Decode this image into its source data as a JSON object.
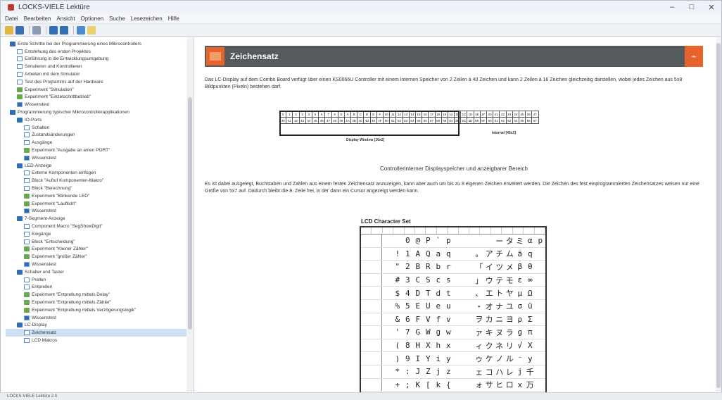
{
  "window": {
    "title": "LOCKS-VIELE Lektüre",
    "controls": [
      "–",
      "□",
      "✕"
    ]
  },
  "menu": [
    "Datei",
    "Bearbeiten",
    "Ansicht",
    "Optionen",
    "Suche",
    "Lesezeichen",
    "Hilfe"
  ],
  "toolbar": {
    "icons": [
      "open-icon",
      "save-icon",
      "print-icon",
      "back-icon",
      "forward-icon",
      "home-icon",
      "search-icon"
    ]
  },
  "tree": [
    {
      "label": "Erste Schritte bei der Programmierung eines Mikrocontrollers",
      "icon": "book",
      "indent": 0
    },
    {
      "label": "Entstehung des ersten Projektes",
      "icon": "doc",
      "indent": 1
    },
    {
      "label": "Einführung in die Entwicklungsumgebung",
      "icon": "doc",
      "indent": 1
    },
    {
      "label": "Simulieren und Kontrollieren",
      "icon": "doc",
      "indent": 1
    },
    {
      "label": "Arbeiten mit dem Simulator",
      "icon": "doc",
      "indent": 1
    },
    {
      "label": "Test des Programms auf der Hardware",
      "icon": "doc",
      "indent": 1
    },
    {
      "label": "Experiment \"Simulation\"",
      "icon": "exp",
      "indent": 1
    },
    {
      "label": "Experiment \"Einzelschrittbetrieb\"",
      "icon": "exp",
      "indent": 1
    },
    {
      "label": "Wissenstest",
      "icon": "know",
      "indent": 1
    },
    {
      "label": "Programmierung typischer Mikrocontrollerapplikationen",
      "icon": "book",
      "indent": 0
    },
    {
      "label": "IO-Ports",
      "icon": "book",
      "indent": 1
    },
    {
      "label": "Schalten",
      "icon": "doc",
      "indent": 2
    },
    {
      "label": "Zustandsänderungen",
      "icon": "doc",
      "indent": 2
    },
    {
      "label": "Ausgänge",
      "icon": "doc",
      "indent": 2
    },
    {
      "label": "Experiment \"Ausgabe an einen PORT\"",
      "icon": "exp",
      "indent": 2
    },
    {
      "label": "Wissenstest",
      "icon": "know",
      "indent": 2
    },
    {
      "label": "LED-Anzeige",
      "icon": "book",
      "indent": 1
    },
    {
      "label": "Externe Komponenten einfügen",
      "icon": "doc",
      "indent": 2
    },
    {
      "label": "Block \"Aufruf Komponenten-Makro\"",
      "icon": "doc",
      "indent": 2
    },
    {
      "label": "Block \"Berechnung\"",
      "icon": "doc",
      "indent": 2
    },
    {
      "label": "Experiment \"Blinkende LED\"",
      "icon": "exp",
      "indent": 2
    },
    {
      "label": "Experiment \"Lauflicht\"",
      "icon": "exp",
      "indent": 2
    },
    {
      "label": "Wissenstest",
      "icon": "know",
      "indent": 2
    },
    {
      "label": "7-Segment-Anzeige",
      "icon": "book",
      "indent": 1
    },
    {
      "label": "Component Macro \"SegShowDigit\"",
      "icon": "doc",
      "indent": 2
    },
    {
      "label": "Eingänge",
      "icon": "doc",
      "indent": 2
    },
    {
      "label": "Block \"Entscheidung\"",
      "icon": "doc",
      "indent": 2
    },
    {
      "label": "Experiment \"Kleiner Zähler\"",
      "icon": "exp",
      "indent": 2
    },
    {
      "label": "Experiment \"großer Zähler\"",
      "icon": "exp",
      "indent": 2
    },
    {
      "label": "Wissenstest",
      "icon": "know",
      "indent": 2
    },
    {
      "label": "Schalter und Taster",
      "icon": "book",
      "indent": 1
    },
    {
      "label": "Prellen",
      "icon": "doc",
      "indent": 2
    },
    {
      "label": "Entprellen",
      "icon": "doc",
      "indent": 2
    },
    {
      "label": "Experiment \"Entprellung mittels Delay\"",
      "icon": "exp",
      "indent": 2
    },
    {
      "label": "Experiment \"Entprellung mittels Zähler\"",
      "icon": "exp",
      "indent": 2
    },
    {
      "label": "Experiment \"Entprellung mittels Verzögerungslogik\"",
      "icon": "exp",
      "indent": 2
    },
    {
      "label": "Wissenstest",
      "icon": "know",
      "indent": 2
    },
    {
      "label": "LC-Display",
      "icon": "book",
      "indent": 1
    },
    {
      "label": "Zeichensatz",
      "icon": "doc",
      "indent": 2,
      "selected": true
    },
    {
      "label": "LCD Makros",
      "icon": "doc",
      "indent": 2
    }
  ],
  "content": {
    "title": "Zeichensatz",
    "para1": "Das LC-Display auf dem Combo Board verfügt über einen KS0066U Controller mit einem internen Speicher von 2 Zeilen à 40 Zeichen und kann 2 Zeilen à 16 Zeichen gleichzeitig darstellen, wobei jedes Zeichen aus 5x8 Bildpunkten (Pixeln) bestehen darf.",
    "table_row1": [
      "0",
      "1",
      "2",
      "3",
      "4",
      "5",
      "6",
      "7",
      "8",
      "9",
      "A",
      "B",
      "C",
      "D",
      "E",
      "F",
      "10",
      "11",
      "12",
      "13",
      "14",
      "15",
      "16",
      "17",
      "18",
      "19",
      "1A",
      "1B",
      "1C",
      "1D",
      "1E",
      "1F",
      "20",
      "21",
      "22",
      "23",
      "24",
      "25",
      "26",
      "27"
    ],
    "table_row2": [
      "40",
      "41",
      "42",
      "43",
      "44",
      "45",
      "46",
      "47",
      "48",
      "49",
      "4A",
      "4B",
      "4C",
      "4D",
      "4E",
      "4F",
      "50",
      "51",
      "52",
      "53",
      "54",
      "55",
      "56",
      "57",
      "58",
      "59",
      "5A",
      "5B",
      "5C",
      "5D",
      "5E",
      "5F",
      "60",
      "61",
      "62",
      "63",
      "64",
      "65",
      "66",
      "67"
    ],
    "display_window_label": "Display Window [16x2]",
    "internal_label": "Internal [40x2]",
    "caption": "Controllerinterner Displayspeicher und anzeigbarer Bereich",
    "para2": "Es ist dabei ausgelegt, Buchstaben und Zahlen aus einem festen Zeichensatz anzuzeigen, kann aber auch um bis zu 8 eigenen Zeichen erweitert werden. Die Zeichen des fest einprogrammierten Zeichensatzes weisen nur eine Größe von 5x7 auf. Dadurch bleibt die 8. Zeile frei, in der dann ein Cursor angezeigt werden kann.",
    "lcd_title": "LCD Character Set",
    "lcd_rows": [
      [
        "",
        "",
        "",
        "0",
        "@",
        "P",
        "`",
        "p",
        "",
        "",
        "",
        "",
        "ー",
        "タ",
        "ミ",
        "α",
        "p"
      ],
      [
        "",
        "",
        "!",
        "1",
        "A",
        "Q",
        "a",
        "q",
        "",
        "",
        "。",
        "ア",
        "チ",
        "ム",
        "ä",
        "q"
      ],
      [
        "",
        "",
        "\"",
        "2",
        "B",
        "R",
        "b",
        "r",
        "",
        "",
        "「",
        "イ",
        "ツ",
        "メ",
        "β",
        "θ"
      ],
      [
        "",
        "",
        "#",
        "3",
        "C",
        "S",
        "c",
        "s",
        "",
        "",
        "」",
        "ウ",
        "テ",
        "モ",
        "ε",
        "∞"
      ],
      [
        "",
        "",
        "$",
        "4",
        "D",
        "T",
        "d",
        "t",
        "",
        "",
        "、",
        "エ",
        "ト",
        "ヤ",
        "μ",
        "Ω"
      ],
      [
        "",
        "",
        "%",
        "5",
        "E",
        "U",
        "e",
        "u",
        "",
        "",
        "・",
        "オ",
        "ナ",
        "ユ",
        "σ",
        "ü"
      ],
      [
        "",
        "",
        "&",
        "6",
        "F",
        "V",
        "f",
        "v",
        "",
        "",
        "ヲ",
        "カ",
        "ニ",
        "ヨ",
        "ρ",
        "Σ"
      ],
      [
        "",
        "",
        "'",
        "7",
        "G",
        "W",
        "g",
        "w",
        "",
        "",
        "ァ",
        "キ",
        "ヌ",
        "ラ",
        "g",
        "π"
      ],
      [
        "",
        "",
        "(",
        "8",
        "H",
        "X",
        "h",
        "x",
        "",
        "",
        "ィ",
        "ク",
        "ネ",
        "リ",
        "√",
        "X"
      ],
      [
        "",
        "",
        ")",
        "9",
        "I",
        "Y",
        "i",
        "y",
        "",
        "",
        "ゥ",
        "ケ",
        "ノ",
        "ル",
        "⁻",
        "y"
      ],
      [
        "",
        "",
        "*",
        ":",
        "J",
        "Z",
        "j",
        "z",
        "",
        "",
        "ェ",
        "コ",
        "ハ",
        "レ",
        "j",
        "千"
      ],
      [
        "",
        "",
        "+",
        ";",
        "K",
        "[",
        "k",
        "{",
        "",
        "",
        "ォ",
        "サ",
        "ヒ",
        "ロ",
        "x",
        "万"
      ]
    ]
  },
  "statusbar": "LOCKS-VIELE Lektüre 2.0"
}
